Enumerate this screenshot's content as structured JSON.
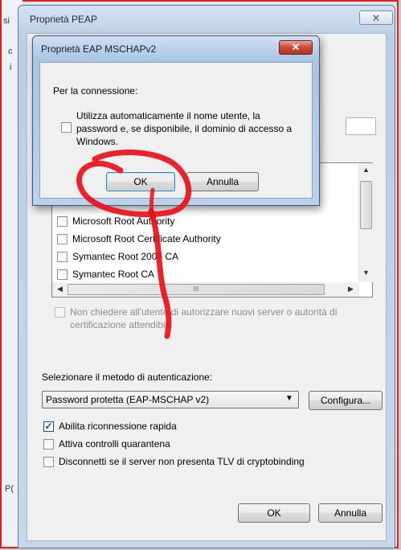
{
  "background": {
    "strip_texts": [
      "si",
      "c",
      "i",
      "P("
    ]
  },
  "peap": {
    "title": "Proprietà PEAP",
    "close_label": "✕",
    "list_items": [
      "Microsoft Root Authority",
      "Microsoft Root Certificate Authority",
      "Symantec Root 2005 CA",
      "Symantec Root CA"
    ],
    "hscroll_grip": "III",
    "no_ask_label": "Non chiedere all'utente di autorizzare nuovi server o autorità di certificazione attendibili.",
    "auth_method_label": "Selezionare il metodo di autenticazione:",
    "auth_method_value": "Password protetta (EAP-MSCHAP v2)",
    "configure_label": "Configura...",
    "options": [
      {
        "label": "Abilita riconnessione rapida",
        "checked": true
      },
      {
        "label": "Attiva controlli quarantena",
        "checked": false
      },
      {
        "label": "Disconnetti se il server non presenta TLV di cryptobinding",
        "checked": false
      }
    ],
    "ok_label": "OK",
    "cancel_label": "Annulla"
  },
  "eap": {
    "title": "Proprietà EAP MSCHAPv2",
    "close_label": "✕",
    "section_label": "Per la connessione:",
    "auto_logon_label": "Utilizza automaticamente il nome utente, la password e, se disponibile, il dominio di accesso a Windows.",
    "auto_logon_checked": false,
    "ok_label": "OK",
    "cancel_label": "Annulla"
  },
  "colors": {
    "annotation": "#e8101a",
    "window_frame": "#5e7996"
  }
}
